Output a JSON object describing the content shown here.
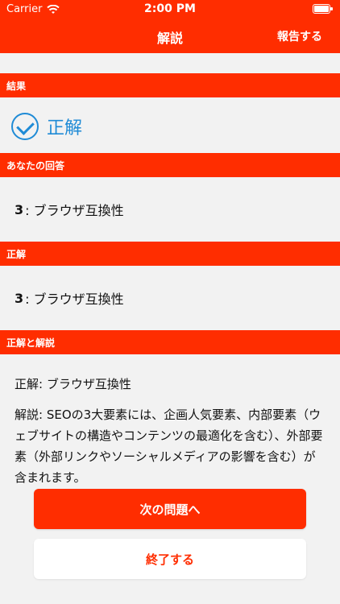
{
  "status_bar": {
    "carrier": "Carrier",
    "time": "2:00 PM"
  },
  "nav": {
    "title": "解説",
    "report_label": "報告する"
  },
  "sections": {
    "result_header": "結果",
    "result_text": "正解",
    "your_answer_header": "あなたの回答",
    "your_answer_num": "3",
    "your_answer_text": ": ブラウザ互換性",
    "correct_header": "正解",
    "correct_num": "3",
    "correct_text": ": ブラウザ互換性",
    "explain_header": "正解と解説",
    "explain_p1": "正解: ブラウザ互換性",
    "explain_p2": "解説: SEOの3大要素には、企画人気要素、内部要素（ウェブサイトの構造やコンテンツの最適化を含む）、外部要素（外部リンクやソーシャルメディアの影響を含む）が含まれます。"
  },
  "buttons": {
    "next_label": "次の問題へ",
    "finish_label": "終了する"
  },
  "colors": {
    "brand": "#ff2d00",
    "accent_blue": "#1f8bd6",
    "background": "#f2f2f2"
  }
}
